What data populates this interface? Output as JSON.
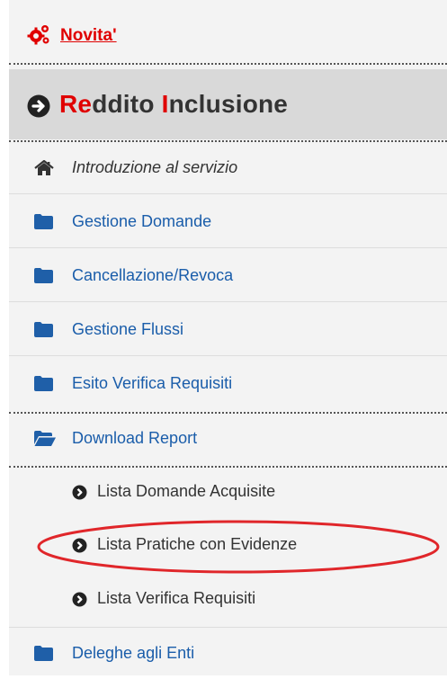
{
  "novita": {
    "label": "Novita'"
  },
  "section": {
    "title_prefix_1": "Re",
    "title_rest_1": "ddito ",
    "title_prefix_2": "I",
    "title_rest_2": "nclusione"
  },
  "menu": {
    "intro": "Introduzione al servizio",
    "items": [
      {
        "label": "Gestione Domande"
      },
      {
        "label": "Cancellazione/Revoca"
      },
      {
        "label": "Gestione Flussi"
      },
      {
        "label": "Esito Verifica Requisiti"
      },
      {
        "label": "Download Report"
      }
    ],
    "sub_items": [
      {
        "label": "Lista Domande Acquisite"
      },
      {
        "label": "Lista Pratiche con Evidenze"
      },
      {
        "label": "Lista Verifica Requisiti"
      }
    ],
    "last": {
      "label": "Deleghe agli Enti"
    }
  },
  "colors": {
    "brand_red": "#e00000",
    "link_blue": "#1a5daa",
    "icon_blue": "#1f5fa8",
    "highlight": "#e0262a"
  },
  "icons": {
    "novita": "gears-icon",
    "section": "circle-arrow-right-icon",
    "intro": "home-icon",
    "folder": "folder-icon",
    "open_folder": "folder-open-icon",
    "sub": "circle-chevron-right-icon"
  }
}
